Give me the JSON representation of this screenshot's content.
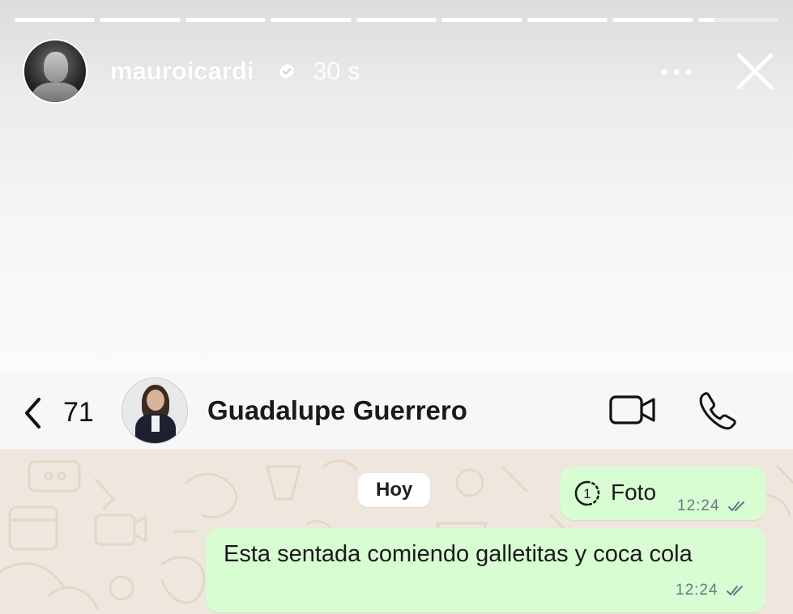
{
  "story": {
    "username": "mauroicardi",
    "time": "30 s",
    "verified": true,
    "progress_segments": 9,
    "active_segment_progress": 0.2
  },
  "chat_header": {
    "back_count": "71",
    "contact_name": "Guadalupe Guerrero"
  },
  "chat": {
    "day_label": "Hoy",
    "messages": [
      {
        "type": "view-once-photo",
        "label": "Foto",
        "time": "12:24",
        "status": "read",
        "view_once_count": "1"
      },
      {
        "type": "text",
        "text": "Esta sentada comiendo galletitas y coca cola",
        "time": "12:24",
        "status": "read"
      }
    ]
  },
  "colors": {
    "outgoing_bubble": "#d9fdd3",
    "chat_background": "#efe7dd",
    "timestamp": "#667781"
  },
  "icons": [
    "verified-badge-icon",
    "more-icon",
    "close-icon",
    "back-chevron-icon",
    "video-call-icon",
    "phone-icon",
    "view-once-icon",
    "double-check-icon"
  ]
}
